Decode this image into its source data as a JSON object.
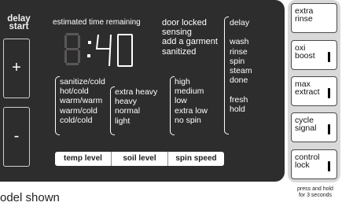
{
  "panel": {
    "delay_start": [
      "delay",
      "start"
    ],
    "plus_label": "+",
    "minus_label": "-",
    "estimated_time_label": "estimated time remaining",
    "time_display": ":40",
    "status_messages": [
      "door locked",
      "sensing",
      "add a garment",
      "sanitized"
    ],
    "cycle_status": [
      "delay",
      "",
      "wash",
      "rinse",
      "spin",
      "steam",
      "done",
      "",
      "fresh",
      "hold"
    ],
    "temp_options": [
      "sanitize/cold",
      "hot/cold",
      "warm/warm",
      "warm/cold",
      "cold/cold"
    ],
    "soil_options": [
      "extra heavy",
      "heavy",
      "normal",
      "light"
    ],
    "spin_options": [
      "high",
      "medium",
      "low",
      "extra low",
      "no spin"
    ],
    "bottom_buttons": [
      "temp level",
      "soil level",
      "spin speed"
    ]
  },
  "options": [
    {
      "line1": "extra",
      "line2": "rinse"
    },
    {
      "line1": "oxi",
      "line2": "boost"
    },
    {
      "line1": "max",
      "line2": "extract"
    },
    {
      "line1": "cycle",
      "line2": "signal"
    },
    {
      "line1": "control",
      "line2": "lock"
    }
  ],
  "press_note": [
    "press and hold",
    "for 3 seconds"
  ],
  "footer_caption": "odel shown",
  "colors": {
    "panel": "#2e2d2d",
    "strip": "#d9d9d9",
    "text": "#ffffff"
  }
}
